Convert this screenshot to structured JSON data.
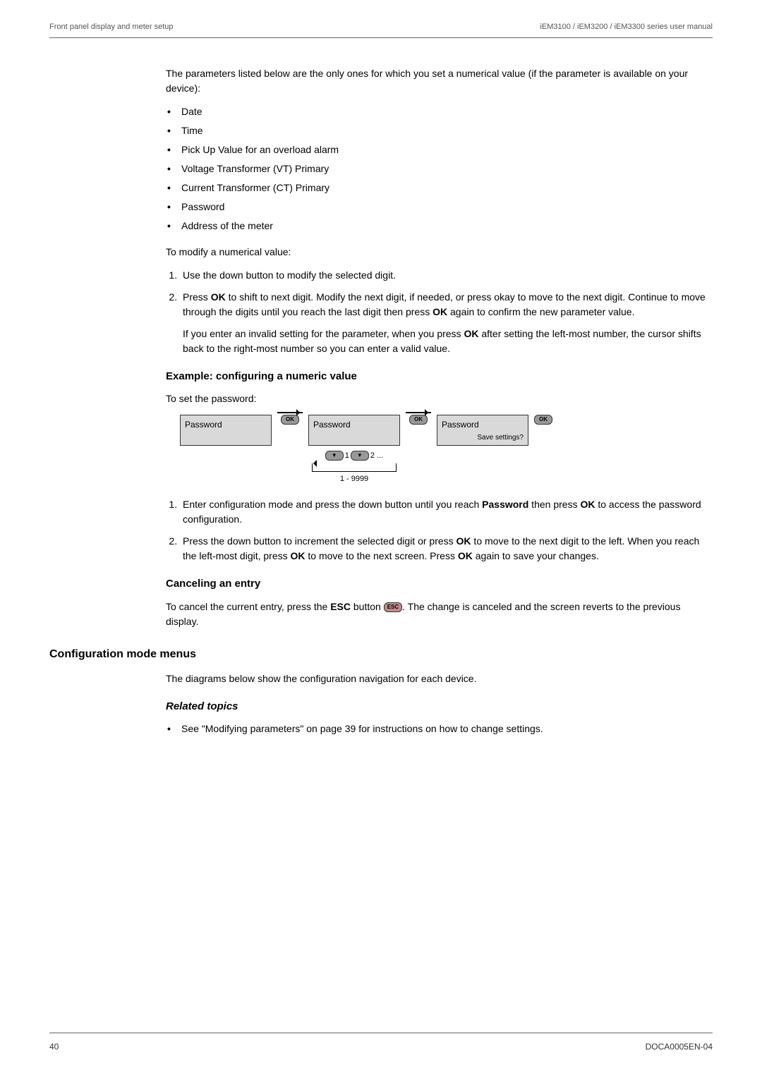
{
  "header": {
    "left": "Front panel display and meter setup",
    "right": "iEM3100 / iEM3200 / iEM3300 series user manual"
  },
  "intro": "The parameters listed below are the only ones for which you set a numerical value (if the parameter is available on your device):",
  "params": [
    "Date",
    "Time",
    "Pick Up Value for an overload alarm",
    "Voltage Transformer (VT) Primary",
    "Current Transformer (CT) Primary",
    "Password",
    "Address of the meter"
  ],
  "modify_intro": "To modify a numerical value:",
  "steps1": [
    {
      "text": "Use the down button to modify the selected digit."
    },
    {
      "text_pre": "Press ",
      "bold1": "OK",
      "text_mid": " to shift to next digit. Modify the next digit, if needed, or press okay to move to the next digit. Continue to move through the digits until you reach the last digit then press ",
      "bold2": "OK",
      "text_post": " again to confirm the new parameter value.",
      "sub_pre": "If you enter an invalid setting for the parameter, when you press ",
      "sub_bold": "OK",
      "sub_post": " after setting the left-most number, the cursor shifts back to the right-most number so you can enter a valid value."
    }
  ],
  "example_heading": "Example: configuring a numeric value",
  "example_intro": "To set the password:",
  "lcd": {
    "screen1": "Password",
    "screen2": "Password",
    "screen3_top": "Password",
    "screen3_bot": "Save settings?",
    "ok": "OK",
    "down": "▼",
    "digits": {
      "d1": "1",
      "d2": "2 ..."
    },
    "range": "1 - 9999"
  },
  "steps2": [
    {
      "pre": "Enter configuration mode and press the down button until you reach ",
      "b1": "Password",
      "mid": " then press ",
      "b2": "OK",
      "post": " to access the password configuration."
    },
    {
      "pre": "Press the down button to increment the selected digit or press ",
      "b1": "OK",
      "mid": " to move to the next digit to the left. When you reach the left-most digit, press ",
      "b2": "OK",
      "mid2": " to move to the next screen. Press ",
      "b3": "OK",
      "post": " again to save your changes."
    }
  ],
  "cancel_heading": "Canceling an entry",
  "cancel": {
    "pre": "To cancel the current entry, press the ",
    "b": "ESC",
    "mid": " button ",
    "key": "ESC",
    "post": ". The change is canceled and the screen reverts to the previous display."
  },
  "config_heading": "Configuration mode menus",
  "config_text": "The diagrams below show the configuration navigation for each device.",
  "related_heading": "Related topics",
  "related_item": "See \"Modifying parameters\" on page 39 for instructions on how to change settings.",
  "footer": {
    "page": "40",
    "doc": "DOCA0005EN-04"
  }
}
